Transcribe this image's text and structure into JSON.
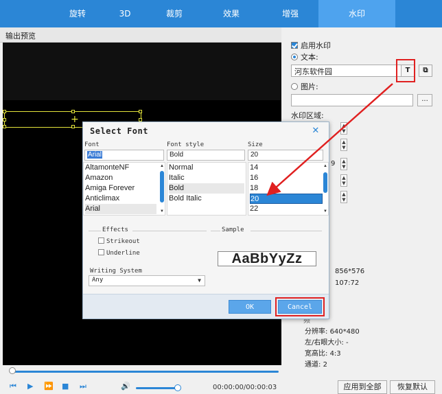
{
  "tabs": [
    {
      "label": "旋转"
    },
    {
      "label": "3D"
    },
    {
      "label": "裁剪"
    },
    {
      "label": "效果"
    },
    {
      "label": "增强"
    },
    {
      "label": "水印",
      "active": true
    }
  ],
  "preview": {
    "label": "输出预览",
    "timecode": "00:00:00/00:00:03",
    "progress": 0.0
  },
  "watermark": {
    "enable_label": "启用水印",
    "enable_checked": true,
    "text_label": "文本:",
    "text_selected": true,
    "text_value": "河东软件园",
    "text_font_button": "T",
    "image_label": "图片:",
    "image_selected": false,
    "image_browse": "...",
    "area_label": "水印区域:",
    "spin_fragment": "9"
  },
  "info": {
    "resolution_a": "856*576",
    "ratio_a": "107:72",
    "section_fragment": "频",
    "resolution_label": "分辨率:",
    "resolution_value": "640*480",
    "eye_label": "左/右眼大小:",
    "eye_value": "-",
    "aspect_label": "宽高比:",
    "aspect_value": "4:3",
    "channel_label": "通道:",
    "channel_value": "2"
  },
  "buttons": {
    "apply_all": "应用到全部",
    "restore_default": "恢复默认"
  },
  "dialog": {
    "title": "Select Font",
    "font_label": "Font",
    "style_label": "Font style",
    "size_label": "Size",
    "font_value": "Arial",
    "style_value": "Bold",
    "size_value": "20",
    "fonts": [
      "AltamonteNF",
      "Amazon",
      "Amiga Forever",
      "Anticlimax",
      "Arial"
    ],
    "selected_font": "Arial",
    "styles": [
      "Normal",
      "Italic",
      "Bold",
      "Bold Italic"
    ],
    "selected_style": "Bold",
    "sizes": [
      "14",
      "16",
      "18",
      "20",
      "22"
    ],
    "selected_size": "20",
    "effects_label": "Effects",
    "strikeout_label": "Strikeout",
    "underline_label": "Underline",
    "sample_label": "Sample",
    "sample_text": "AaBbYyZz",
    "writing_system_label": "Writing System",
    "writing_system_value": "Any",
    "ok_label": "OK",
    "cancel_label": "Cancel"
  },
  "colors": {
    "accent": "#2b86d6",
    "highlight_red": "#e02020",
    "watermark_box": "#e5e53b"
  },
  "icons": {
    "close": "close-icon",
    "copy": "copy-icon",
    "prev": "skip-back-icon",
    "play": "play-icon",
    "next": "fast-forward-icon",
    "stop": "stop-icon",
    "end": "skip-end-icon",
    "volume": "volume-icon"
  }
}
